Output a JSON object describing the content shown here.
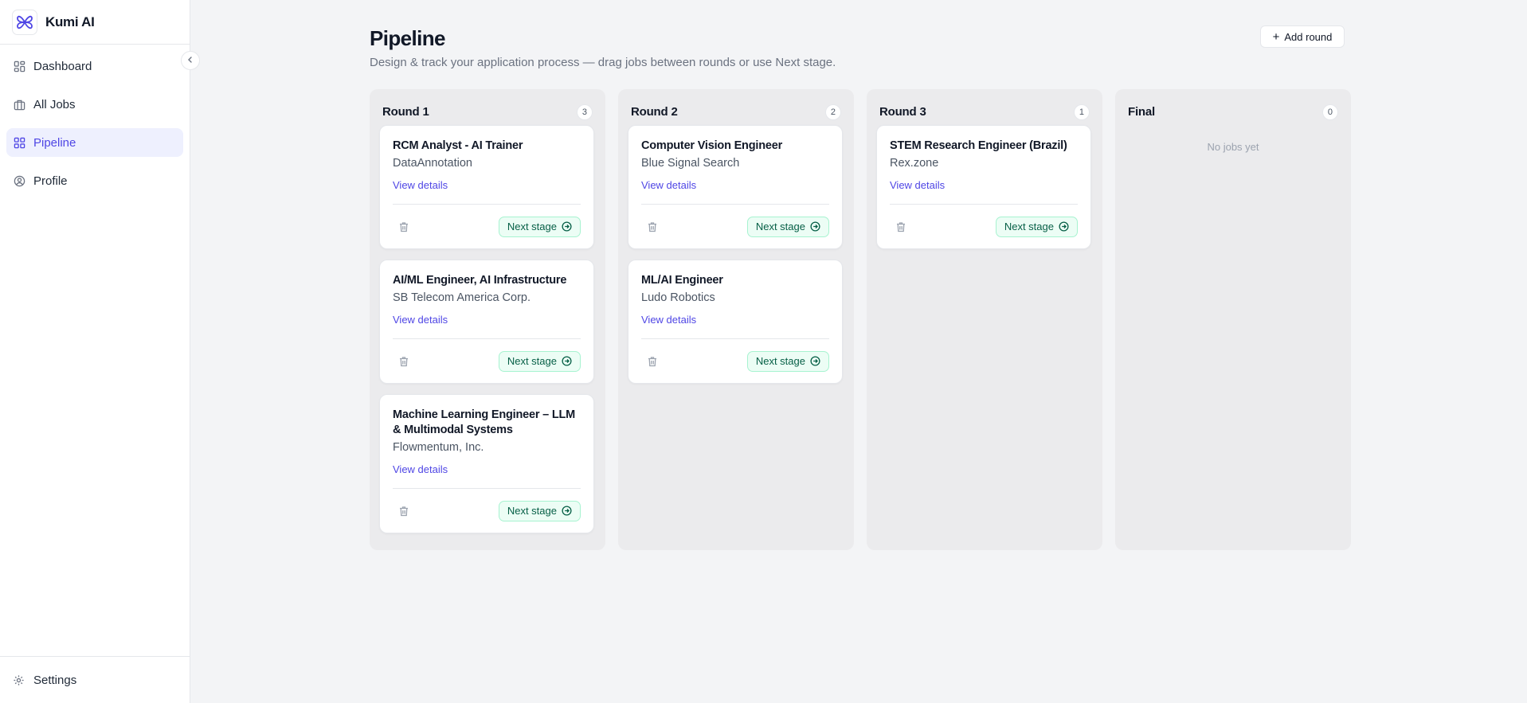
{
  "app": {
    "name": "Kumi AI"
  },
  "sidebar": {
    "items": [
      {
        "label": "Dashboard",
        "icon": "dashboard-icon"
      },
      {
        "label": "All Jobs",
        "icon": "briefcase-icon"
      },
      {
        "label": "Pipeline",
        "icon": "grid-icon",
        "active": true
      },
      {
        "label": "Profile",
        "icon": "user-circle-icon"
      }
    ],
    "footer": {
      "label": "Settings",
      "icon": "gear-icon"
    }
  },
  "header": {
    "title": "Pipeline",
    "subtitle": "Design & track your application process — drag jobs between rounds or use Next stage.",
    "add_round_label": "Add round"
  },
  "card_labels": {
    "view_details": "View details",
    "next_stage": "Next stage"
  },
  "columns": [
    {
      "title": "Round 1",
      "count": "3",
      "cards": [
        {
          "title": "RCM Analyst - AI Trainer",
          "company": "DataAnnotation"
        },
        {
          "title": "AI/ML Engineer, AI Infrastructure",
          "company": "SB Telecom America Corp."
        },
        {
          "title": "Machine Learning Engineer – LLM & Multimodal Systems",
          "company": "Flowmentum, Inc."
        }
      ]
    },
    {
      "title": "Round 2",
      "count": "2",
      "cards": [
        {
          "title": "Computer Vision Engineer",
          "company": "Blue Signal Search"
        },
        {
          "title": "ML/AI Engineer",
          "company": "Ludo Robotics"
        }
      ]
    },
    {
      "title": "Round 3",
      "count": "1",
      "cards": [
        {
          "title": "STEM Research Engineer (Brazil)",
          "company": "Rex.zone"
        }
      ]
    },
    {
      "title": "Final",
      "count": "0",
      "cards": [],
      "empty_text": "No jobs yet"
    }
  ],
  "colors": {
    "accent": "#4f46e5",
    "active_bg": "#eef0fe",
    "success_bg": "#ecfdf5",
    "success_text": "#065f46"
  }
}
